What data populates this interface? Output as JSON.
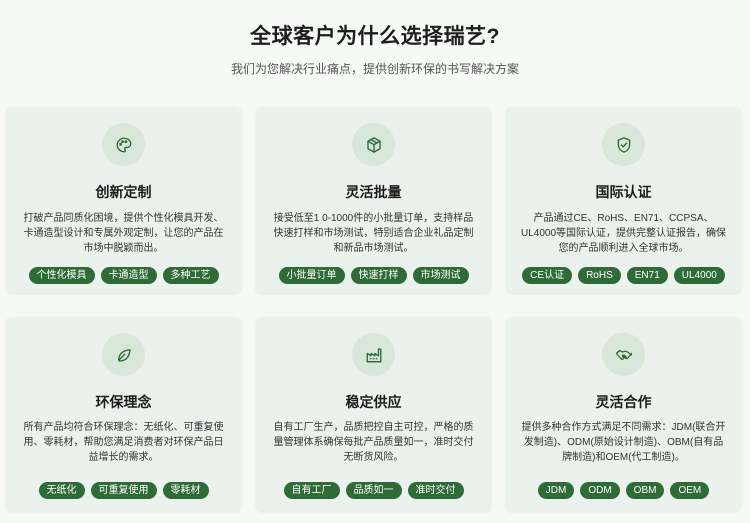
{
  "header": {
    "title": "全球客户为什么选择瑞艺?",
    "subtitle": "我们为您解决行业痛点，提供创新环保的书写解决方案"
  },
  "colors": {
    "accent": "#2e6b36",
    "card_bg": "#ebf1ec",
    "icon_bg": "#d8e7da"
  },
  "cards": [
    {
      "icon": "palette-icon",
      "title": "创新定制",
      "desc": "打破产品同质化困境，提供个性化模具开发、卡通造型设计和专属外观定制，让您的产品在市场中脱颖而出。",
      "tags": [
        "个性化模具",
        "卡通造型",
        "多种工艺"
      ]
    },
    {
      "icon": "box-icon",
      "title": "灵活批量",
      "desc": "接受低至1 0-1000件的小批量订单，支持样品快速打样和市场测试，特别适合企业礼品定制和新品市场测试。",
      "tags": [
        "小批量订单",
        "快速打样",
        "市场测试"
      ]
    },
    {
      "icon": "shield-check-icon",
      "title": "国际认证",
      "desc": "产品通过CE、RoHS、EN71、CCPSA、UL4000等国际认证，提供完整认证报告，确保您的产品顺利进入全球市场。",
      "tags": [
        "CE认证",
        "RoHS",
        "EN71",
        "UL4000"
      ]
    },
    {
      "icon": "leaf-icon",
      "title": "环保理念",
      "desc": "所有产品均符合环保理念：无纸化、可重复使用、零耗材，帮助您满足消费者对环保产品日益增长的需求。",
      "tags": [
        "无纸化",
        "可重复使用",
        "零耗材"
      ]
    },
    {
      "icon": "factory-icon",
      "title": "稳定供应",
      "desc": "自有工厂生产，品质把控自主可控，严格的质量管理体系确保每批产品质量如一，准时交付无断货风险。",
      "tags": [
        "自有工厂",
        "品质如一",
        "准时交付"
      ]
    },
    {
      "icon": "handshake-icon",
      "title": "灵活合作",
      "desc": "提供多种合作方式满足不同需求：JDM(联合开发制造)、ODM(原始设计制造)、OBM(自有品牌制造)和OEM(代工制造)。",
      "tags": [
        "JDM",
        "ODM",
        "OBM",
        "OEM"
      ]
    }
  ]
}
